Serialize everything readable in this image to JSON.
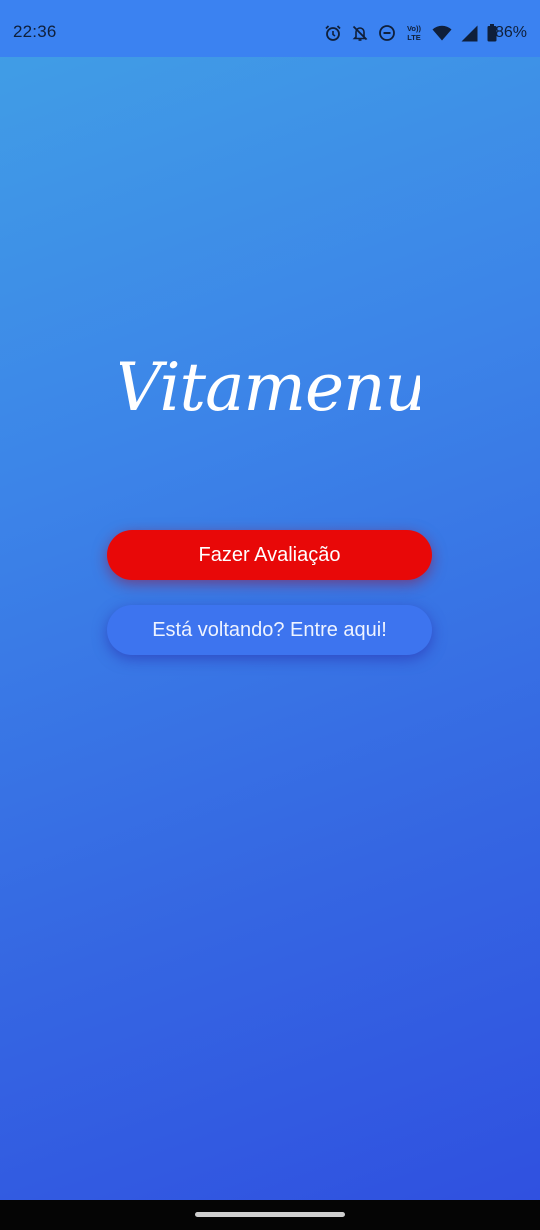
{
  "status_bar": {
    "time": "22:36",
    "icons": [
      "alarm-icon",
      "notifications-off-icon",
      "do-not-disturb-icon",
      "volte-icon",
      "wifi-icon",
      "cell-signal-icon",
      "battery-icon"
    ],
    "volte_top": "Vo))",
    "volte_bottom": "LTE",
    "battery_percent": "86%"
  },
  "logo": {
    "text": "Vitamenu"
  },
  "buttons": {
    "primary_label": "Fazer Avaliação",
    "secondary_label": "Está voltando? Entre aqui!"
  },
  "colors": {
    "status_bar": "#3b82f1",
    "background_top": "#41a0e6",
    "background_bottom": "#2f4fe0",
    "primary_button": "#e80808",
    "secondary_button": "#3d74ef",
    "text_on_button": "#ffffff"
  }
}
